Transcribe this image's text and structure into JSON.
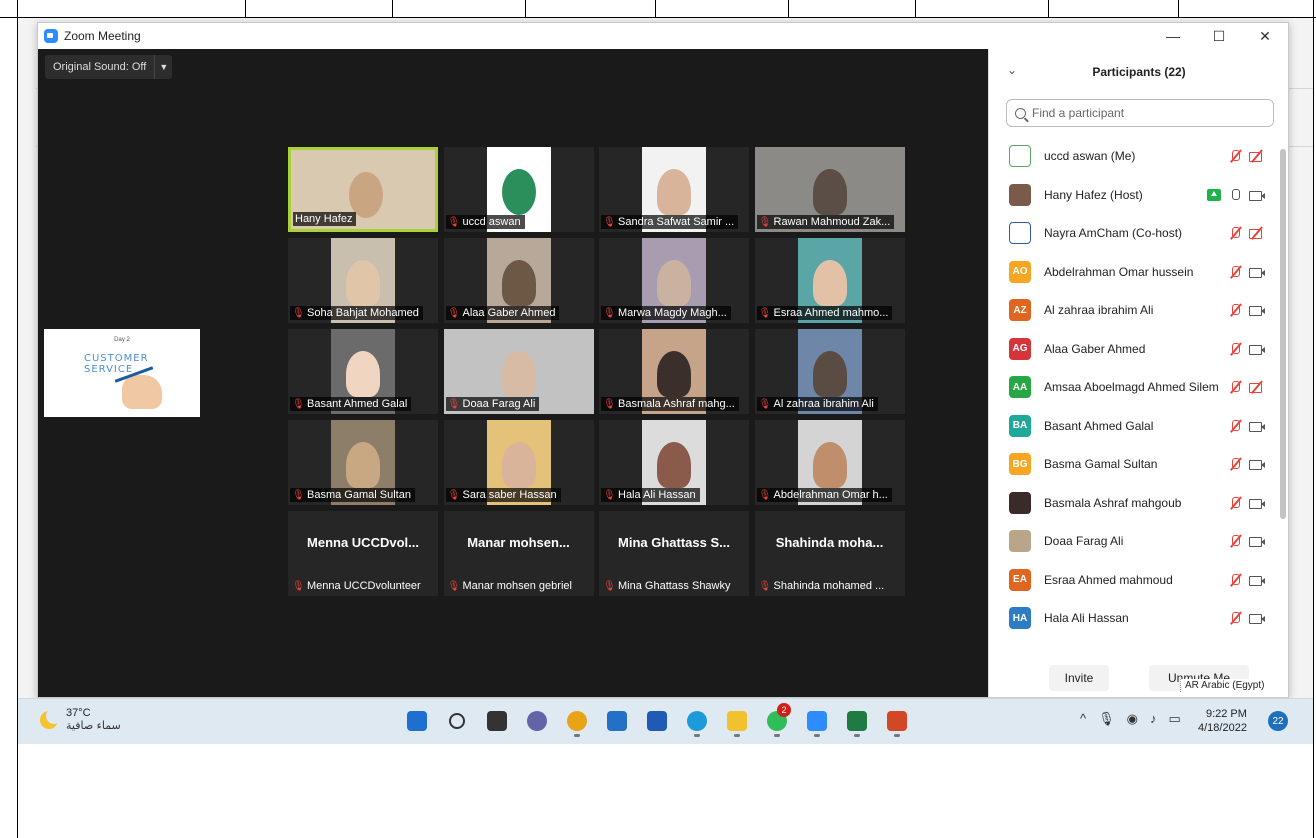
{
  "window": {
    "title": "Zoom Meeting",
    "minimize": "—",
    "maximize": "☐",
    "close": "✕"
  },
  "meeting": {
    "original_sound": "Original Sound: Off",
    "share_thumb": {
      "day": "Day 2",
      "text": "CUSTOMER SERVICE"
    },
    "tiles": [
      {
        "name": "Hany Hafez",
        "muted": false,
        "video": true,
        "active": true
      },
      {
        "name": "uccd aswan",
        "muted": true,
        "video": true
      },
      {
        "name": "Sandra Safwat Samir ...",
        "muted": true,
        "video": true
      },
      {
        "name": "Rawan Mahmoud Zak...",
        "muted": true,
        "video": true
      },
      {
        "name": "Soha Bahjat Mohamed",
        "muted": true,
        "video": true
      },
      {
        "name": "Alaa Gaber Ahmed",
        "muted": true,
        "video": true
      },
      {
        "name": "Marwa Magdy Magh...",
        "muted": true,
        "video": true
      },
      {
        "name": "Esraa Ahmed mahmo...",
        "muted": true,
        "video": true
      },
      {
        "name": "Basant Ahmed Galal",
        "muted": true,
        "video": true
      },
      {
        "name": "Doaa Farag Ali",
        "muted": true,
        "video": true
      },
      {
        "name": "Basmala Ashraf mahg...",
        "muted": true,
        "video": true
      },
      {
        "name": "Al zahraa ibrahim Ali",
        "muted": true,
        "video": true
      },
      {
        "name": "Basma Gamal Sultan",
        "muted": true,
        "video": true
      },
      {
        "name": "Sara saber Hassan",
        "muted": true,
        "video": true
      },
      {
        "name": "Hala Ali Hassan",
        "muted": true,
        "video": true
      },
      {
        "name": "Abdelrahman Omar h...",
        "muted": true,
        "video": true
      },
      {
        "name": "Menna UCCDvolunteer",
        "display": "Menna UCCDvol...",
        "muted": true,
        "video": false
      },
      {
        "name": "Manar mohsen gebriel",
        "display": "Manar mohsen...",
        "muted": true,
        "video": false
      },
      {
        "name": "Mina Ghattass Shawky",
        "display": "Mina Ghattass S...",
        "muted": true,
        "video": false
      },
      {
        "name": "Shahinda mohamed ...",
        "display": "Shahinda moha...",
        "muted": true,
        "video": false
      }
    ]
  },
  "participants": {
    "title": "Participants (22)",
    "search_placeholder": "Find a participant",
    "list": [
      {
        "name": "uccd aswan (Me)",
        "avatar": "logo",
        "color": "#5aa469",
        "mic": "off",
        "cam": "off"
      },
      {
        "name": "Hany Hafez (Host)",
        "avatar": "photo",
        "color": "#7a5a48",
        "mic": "on",
        "cam": "on",
        "sharing": true
      },
      {
        "name": "Nayra AmCham (Co-host)",
        "avatar": "logo",
        "color": "#2e5aa8",
        "mic": "off",
        "cam": "off"
      },
      {
        "name": "Abdelrahman Omar hussein",
        "avatar": "AO",
        "color": "#f5a623",
        "mic": "off",
        "cam": "on"
      },
      {
        "name": "Al zahraa ibrahim Ali",
        "avatar": "AZ",
        "color": "#e0661f",
        "mic": "off",
        "cam": "on"
      },
      {
        "name": "Alaa Gaber Ahmed",
        "avatar": "AG",
        "color": "#d6343b",
        "mic": "off",
        "cam": "on"
      },
      {
        "name": "Amsaa Aboelmagd Ahmed Silem",
        "avatar": "AA",
        "color": "#27a844",
        "mic": "off",
        "cam": "off"
      },
      {
        "name": "Basant Ahmed Galal",
        "avatar": "BA",
        "color": "#20a89a",
        "mic": "off",
        "cam": "on"
      },
      {
        "name": "Basma Gamal Sultan",
        "avatar": "BG",
        "color": "#f5a623",
        "mic": "off",
        "cam": "on"
      },
      {
        "name": "Basmala Ashraf mahgoub",
        "avatar": "photo",
        "color": "#3a2a2a",
        "mic": "off",
        "cam": "on"
      },
      {
        "name": "Doaa Farag Ali",
        "avatar": "photo",
        "color": "#b9a58a",
        "mic": "off",
        "cam": "on"
      },
      {
        "name": "Esraa Ahmed mahmoud",
        "avatar": "EA",
        "color": "#e0661f",
        "mic": "off",
        "cam": "on"
      },
      {
        "name": "Hala Ali Hassan",
        "avatar": "HA",
        "color": "#2e7cc4",
        "mic": "off",
        "cam": "on"
      }
    ],
    "invite": "Invite",
    "unmute_me": "Unmute Me"
  },
  "language_indicator": "AR Arabic (Egypt)",
  "taskbar": {
    "temperature": "37°C",
    "condition": "سماء صافية",
    "time": "9:22 PM",
    "date": "4/18/2022",
    "notifications": "22",
    "whatsapp_badge": "2",
    "apps": [
      "start-icon",
      "search-icon",
      "task-view-icon",
      "chat-icon",
      "chrome-icon",
      "store-icon",
      "mail-icon",
      "edge-icon",
      "file-explorer-icon",
      "whatsapp-icon",
      "zoom-icon",
      "excel-icon",
      "powerpoint-icon"
    ],
    "colors": {
      "start": "#1f6fd1",
      "chrome": "#e8a317",
      "store": "#2470c7",
      "mail": "#1f5bb4",
      "edge": "#1d9bd8",
      "explorer": "#f2c12e",
      "whatsapp": "#2ebd59",
      "zoom": "#2d8cff",
      "excel": "#1f7a43",
      "powerpoint": "#d24726"
    }
  }
}
